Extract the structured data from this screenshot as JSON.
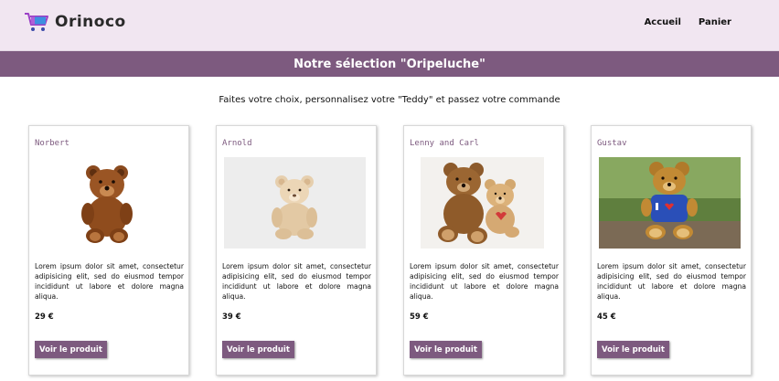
{
  "header": {
    "logo_text": "Orinoco",
    "nav": [
      {
        "label": "Accueil"
      },
      {
        "label": "Panier"
      }
    ]
  },
  "banner": {
    "title": "Notre sélection \"Oripeluche\""
  },
  "intro": {
    "text": "Faites votre choix, personnalisez votre \"Teddy\" et passez votre commande"
  },
  "products": [
    {
      "name": "Norbert",
      "description": "Lorem ipsum dolor sit amet, consectetur adipisicing elit, sed do eiusmod tempor incididunt ut labore et dolore magna aliqua.",
      "price": "29 €",
      "button_label": "Voir le produit",
      "image_icon": "brown-teddy-bear-image"
    },
    {
      "name": "Arnold",
      "description": "Lorem ipsum dolor sit amet, consectetur adipisicing elit, sed do eiusmod tempor incididunt ut labore et dolore magna aliqua.",
      "price": "39 €",
      "button_label": "Voir le produit",
      "image_icon": "beige-teddy-bear-image"
    },
    {
      "name": "Lenny and Carl",
      "description": "Lorem ipsum dolor sit amet, consectetur adipisicing elit, sed do eiusmod tempor incididunt ut labore et dolore magna aliqua.",
      "price": "59 €",
      "button_label": "Voir le produit",
      "image_icon": "two-teddy-bears-image"
    },
    {
      "name": "Gustav",
      "description": "Lorem ipsum dolor sit amet, consectetur adipisicing elit, sed do eiusmod tempor incididunt ut labore et dolore magna aliqua.",
      "price": "45 €",
      "button_label": "Voir le produit",
      "image_icon": "teddy-bear-blue-shirt-image"
    }
  ],
  "colors": {
    "accent": "#7d5a7f",
    "header_bg": "#f1e6f1"
  }
}
